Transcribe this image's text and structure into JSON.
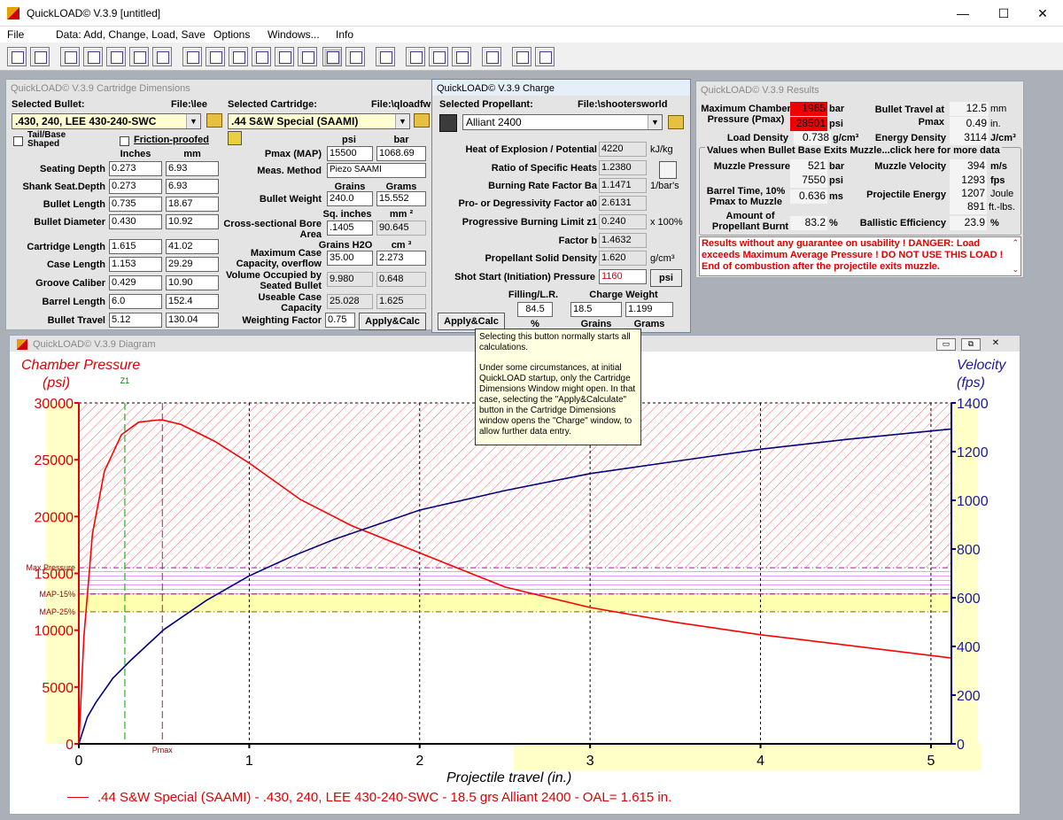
{
  "title": "QuickLOAD© V.3.9  [untitled]",
  "menu": [
    "File",
    "Data: Add, Change, Load, Save",
    "Options",
    "Windows...",
    "Info"
  ],
  "dims": {
    "title": "QuickLOAD© V.3.9 Cartridge Dimensions",
    "sel_bullet_lbl": "Selected Bullet:",
    "bullet_file": "File:\\lee",
    "bullet": ".430, 240, LEE 430-240-SWC",
    "sel_cart_lbl": "Selected Cartridge:",
    "cart_file": "File:\\qloadfw",
    "cartridge": ".44 S&W Special (SAAMI)",
    "tail_base": "Tail/Base Shaped",
    "friction": "Friction-proofed",
    "inches": "Inches",
    "mm": "mm",
    "rows": [
      {
        "label": "Seating Depth",
        "in": "0.273",
        "mm": "6.93"
      },
      {
        "label": "Shank Seat.Depth",
        "in": "0.273",
        "mm": "6.93"
      },
      {
        "label": "Bullet Length",
        "in": "0.735",
        "mm": "18.67"
      },
      {
        "label": "Bullet Diameter",
        "in": "0.430",
        "mm": "10.92"
      },
      {
        "label": "Cartridge Length",
        "in": "1.615",
        "mm": "41.02"
      },
      {
        "label": "Case Length",
        "in": "1.153",
        "mm": "29.29"
      },
      {
        "label": "Groove Caliber",
        "in": "0.429",
        "mm": "10.90"
      },
      {
        "label": "Barrel Length",
        "in": "6.0",
        "mm": "152.4"
      },
      {
        "label": "Bullet Travel",
        "in": "5.12",
        "mm": "130.04"
      }
    ],
    "psi": "psi",
    "bar": "bar",
    "pmax_lbl": "Pmax (MAP)",
    "pmax_psi": "15500",
    "pmax_bar": "1068.69",
    "meas_lbl": "Meas. Method",
    "meas": "Piezo SAAMI",
    "grains": "Grains",
    "grams": "Grams",
    "bw_lbl": "Bullet Weight",
    "bw_gr": "240.0",
    "bw_g": "15.552",
    "sqin": "Sq. inches",
    "mm2": "mm ²",
    "area_lbl": "Cross-sectional Bore Area",
    "area_in": ".1405",
    "area_mm": "90.645",
    "gh2o": "Grains H2O",
    "cm3": "cm ³",
    "mcc_lbl": "Maximum Case Capacity, overflow",
    "mcc_gr": "35.00",
    "mcc_cm": "2.273",
    "vob_lbl": "Volume Occupied by Seated Bullet",
    "vob_gr": "9.980",
    "vob_cm": "0.648",
    "ucc_lbl": "Useable Case Capacity",
    "ucc_gr": "25.028",
    "ucc_cm": "1.625",
    "wf_lbl": "Weighting Factor",
    "wf": "0.75",
    "apply": "Apply&Calc"
  },
  "charge": {
    "title": "QuickLOAD© V.3.9 Charge",
    "sel_lbl": "Selected Propellant:",
    "file": "File:\\shootersworld",
    "propellant": "Alliant 2400",
    "rows": [
      {
        "label": "Heat of Explosion / Potential",
        "val": "4220",
        "unit": "kJ/kg"
      },
      {
        "label": "Ratio of Specific Heats",
        "val": "1.2380",
        "unit": ""
      },
      {
        "label": "Burning Rate Factor  Ba",
        "val": "1.1471",
        "unit": "1/bar's"
      },
      {
        "label": "Pro- or Degressivity Factor  a0",
        "val": "2.6131",
        "unit": ""
      },
      {
        "label": "Progressive Burning Limit z1",
        "val": "0.240",
        "unit": "x 100%"
      },
      {
        "label": "Factor  b",
        "val": "1.4632",
        "unit": ""
      },
      {
        "label": "Propellant Solid Density",
        "val": "1.620",
        "unit": "g/cm³"
      }
    ],
    "shot_lbl": "Shot Start (Initiation) Pressure",
    "shot": "1160",
    "psi_btn": "psi",
    "fill_lbl": "Filling/L.R.",
    "cw_lbl": "Charge Weight",
    "fill": "84.5",
    "cw_gr": "18.5",
    "cw_g": "1.199",
    "pct": "%",
    "grains": "Grains",
    "grams": "Grams",
    "apply": "Apply&Calc"
  },
  "results": {
    "title": "QuickLOAD© V.3.9 Results",
    "mcp_lbl": "Maximum Chamber Pressure (Pmax)",
    "mcp_bar": "1965",
    "mcp_psi": "28501",
    "bar": "bar",
    "psi": "psi",
    "bt_lbl": "Bullet Travel at Pmax",
    "bt_mm": "12.5",
    "bt_in": "0.49",
    "mm": "mm",
    "in": "in.",
    "ld_lbl": "Load Density",
    "ld": "0.738",
    "gcm": "g/cm³",
    "ed_lbl": "Energy Density",
    "ed": "3114",
    "jcm": "J/cm³",
    "muzzle_hdr": "Values when Bullet Base Exits Muzzle...click here for more data",
    "mp_lbl": "Muzzle Pressure",
    "mp_bar": "521",
    "mp_psi": "7550",
    "mv_lbl": "Muzzle Velocity",
    "mv_ms": "394",
    "mv_fps": "1293",
    "ms": "m/s",
    "fps": "fps",
    "btime_lbl": "Barrel Time, 10% Pmax to Muzzle",
    "btime": "0.636",
    "msu": "ms",
    "pe_lbl": "Projectile Energy",
    "pe_j": "1207",
    "pe_ft": "891",
    "joule": "Joule",
    "ftlbs": "ft.-lbs.",
    "apb_lbl": "Amount of Propellant Burnt",
    "apb": "83.2",
    "pctu": "%",
    "be_lbl": "Ballistic Efficiency",
    "be": "23.9",
    "warning": "Results without any guarantee on usability !  DANGER: Load exceeds Maximum Average Pressure ! DO NOT USE THIS LOAD !   End of combustion after the projectile exits muzzle."
  },
  "tooltip": [
    "Selecting this button normally starts all calculations.",
    "Under some circumstances, at initial QuickLOAD startup, only the Cartridge Dimensions Window might open. In that case, selecting the \"Apply&Calculate\" button in the Cartridge Dimensions window opens the \"Charge\" window, to allow further data entry."
  ],
  "diagram_title": "QuickLOAD© V.3.9 Diagram",
  "chart_data": {
    "type": "line",
    "ylabel_left": [
      "Chamber Pressure",
      "(psi)"
    ],
    "ylabel_right": [
      "Velocity",
      "(fps)"
    ],
    "xlabel": "Projectile travel (in.)",
    "xlim": [
      0,
      5.12
    ],
    "ylim_left": [
      0,
      30000
    ],
    "ylim_right": [
      0,
      1400
    ],
    "x_ticks": [
      0,
      1,
      2,
      3,
      4,
      5
    ],
    "y_ticks_left": [
      0,
      5000,
      10000,
      15000,
      20000,
      25000,
      30000
    ],
    "y_ticks_right": [
      0,
      200,
      400,
      600,
      800,
      1000,
      1200,
      1400
    ],
    "markers": [
      "Max.Pressure",
      "MAP-15%",
      "MAP-25%"
    ],
    "marker_values": [
      15500,
      13175,
      11625
    ],
    "z1_label": "Z1",
    "z1_x": 0.27,
    "pmax_label": "Pmax",
    "pmax_x": 0.49,
    "legend": ".44 S&W Special (SAAMI) - .430, 240, LEE 430-240-SWC - 18.5 grs Alliant 2400 - OAL= 1.615 in.",
    "series": [
      {
        "axis": "left",
        "color": "#ff0000",
        "x": [
          0,
          0.03,
          0.08,
          0.15,
          0.25,
          0.35,
          0.45,
          0.49,
          0.6,
          0.8,
          1.0,
          1.3,
          1.6,
          2.0,
          2.5,
          3.0,
          3.5,
          4.0,
          4.5,
          5.12
        ],
        "y": [
          0,
          9500,
          18500,
          24000,
          27200,
          28300,
          28480,
          28501,
          28100,
          26600,
          24700,
          21500,
          19200,
          16800,
          13800,
          12000,
          10700,
          9600,
          8700,
          7550
        ]
      },
      {
        "axis": "right",
        "color": "#000080",
        "x": [
          0,
          0.05,
          0.1,
          0.2,
          0.3,
          0.5,
          0.75,
          1.0,
          1.25,
          1.5,
          2.0,
          2.5,
          3.0,
          3.5,
          4.0,
          4.5,
          5.12
        ],
        "y": [
          0,
          110,
          170,
          270,
          340,
          470,
          590,
          690,
          770,
          840,
          960,
          1040,
          1110,
          1160,
          1210,
          1250,
          1293
        ]
      }
    ]
  }
}
